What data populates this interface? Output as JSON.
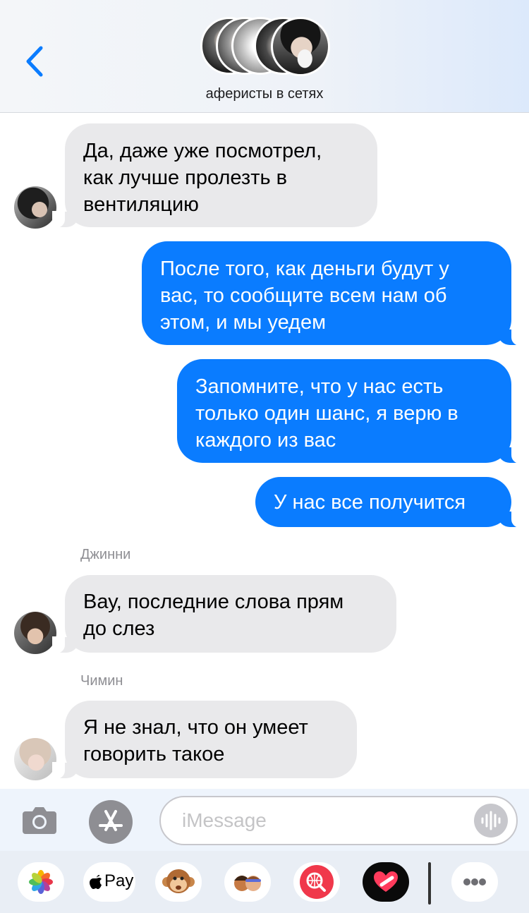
{
  "header": {
    "group_name": "аферисты в сетях"
  },
  "messages": [
    {
      "type": "incoming",
      "text": "Да, даже уже посмотрел,\nкак лучше пролезть в\nвентиляцию"
    },
    {
      "type": "outgoing",
      "text": "После того, как деньги будут у\nвас, то сообщите всем нам об\nэтом, и мы уедем"
    },
    {
      "type": "outgoing",
      "text": "Запомните, что у нас есть\nтолько один шанс, я верю в\nкаждого из вас"
    },
    {
      "type": "outgoing",
      "text": "У нас все получится"
    },
    {
      "type": "incoming",
      "sender": "Джинни",
      "text": "Вау, последние слова прям\nдо слез"
    },
    {
      "type": "incoming",
      "sender": "Чимин",
      "text": "Я не знал, что он умеет\nговорить такое"
    }
  ],
  "composer": {
    "placeholder": "iMessage"
  },
  "apps": {
    "apple_pay_label": "Pay"
  },
  "colors": {
    "outgoing_bubble": "#0a7cff",
    "incoming_bubble": "#e9e9eb",
    "accent": "#0a7cff"
  }
}
